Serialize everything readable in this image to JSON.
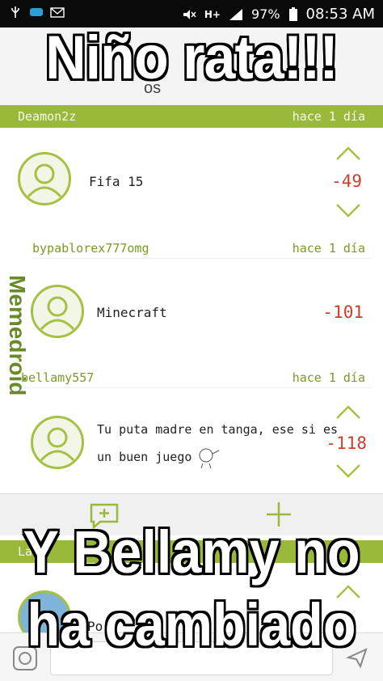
{
  "status_bar": {
    "battery": "97%",
    "time": "08:53 AM",
    "network": "H+",
    "icons": [
      "usb-icon",
      "voicemail-icon",
      "mail-icon",
      "mute-icon",
      "signal-icon",
      "battery-icon"
    ]
  },
  "meme": {
    "top_caption": "Niño rata!!!",
    "bottom_caption_line1": "Y Bellamy no",
    "bottom_caption_line2": "ha cambiado",
    "watermark": "Memedroid"
  },
  "appbar": {
    "subtitle_partial": "os"
  },
  "comments": [
    {
      "user": "Deamon2z",
      "time": "hace 1 día",
      "text": "Fifa 15",
      "score": "-49"
    },
    {
      "user": "bypablorex777omg",
      "time": "hace 1 día",
      "text": "Minecraft",
      "score": "-101"
    },
    {
      "user": "bellamy557",
      "time": "hace 1 día",
      "text_line1": "Tu puta madre en tanga, ese si es",
      "text_line2": "un buen juego",
      "score": "-118"
    }
  ],
  "lower": {
    "user_partial": "La",
    "text_partial": "Po"
  },
  "colors": {
    "accent_green": "#9ab83a",
    "score_red": "#cf3d2b"
  }
}
